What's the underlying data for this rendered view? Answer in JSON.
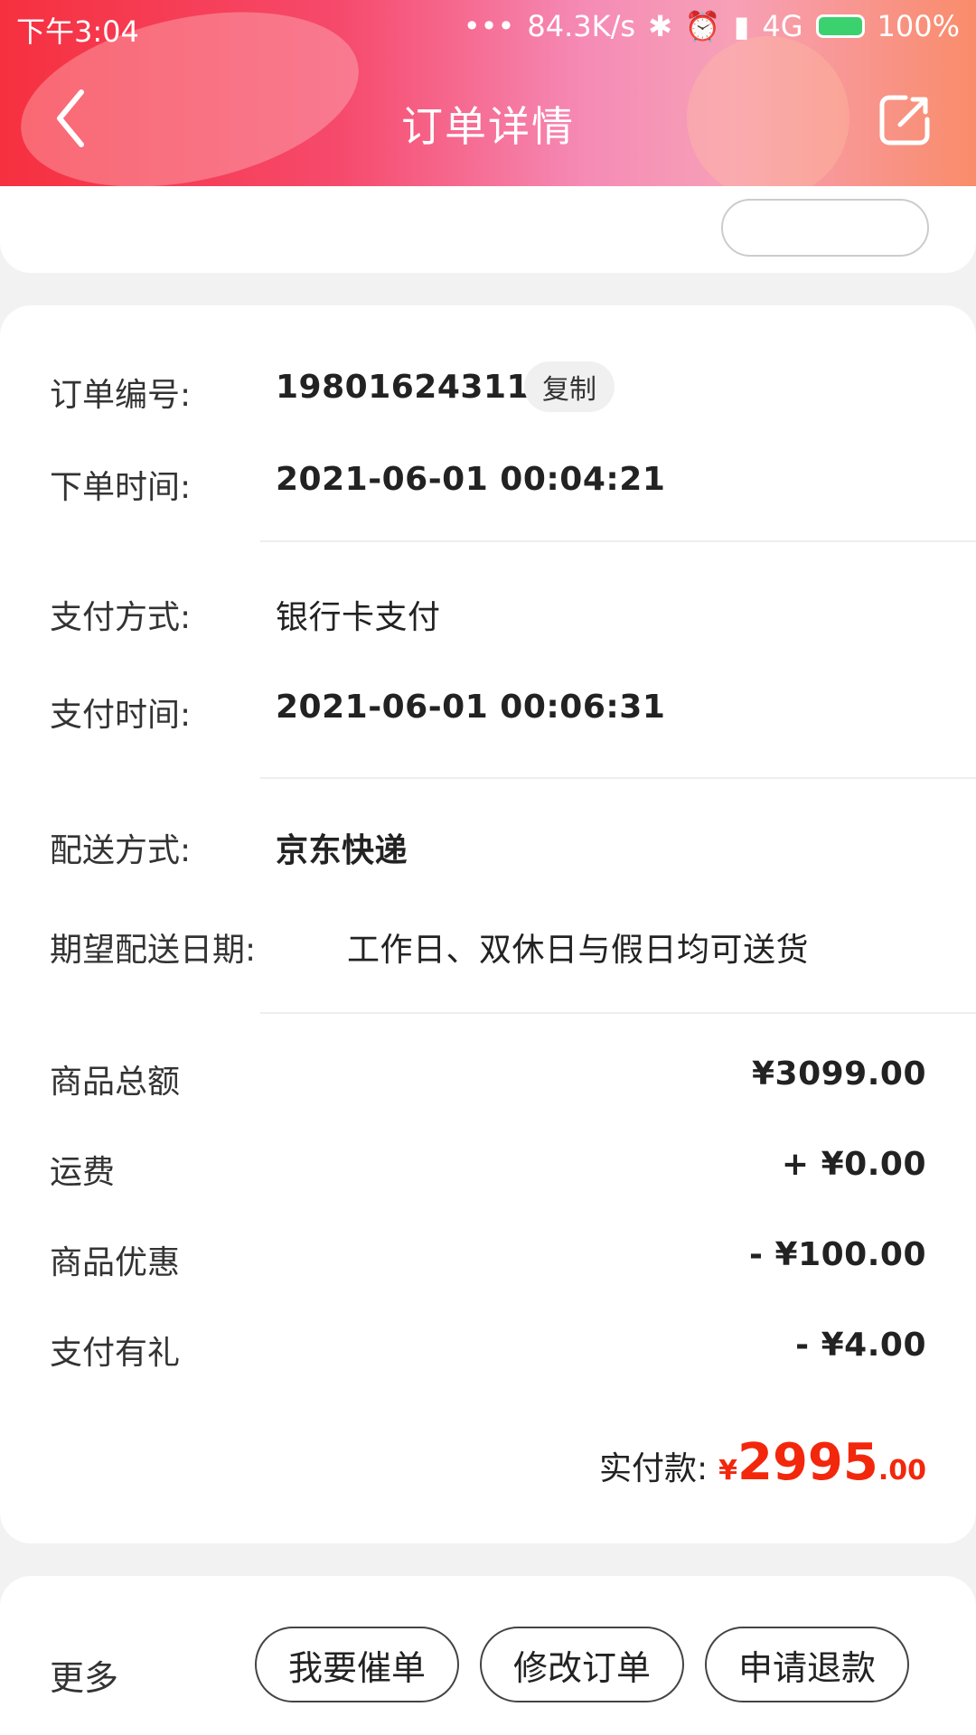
{
  "status_bar": {
    "time": "下午3:04",
    "dots": "•••",
    "speed": "84.3K/s",
    "network": "4G",
    "battery": "100%"
  },
  "nav": {
    "title": "订单详情"
  },
  "order": {
    "number_label": "订单编号:",
    "number": "198016243112",
    "copy_label": "复制",
    "time_label": "下单时间:",
    "time": "2021-06-01 00:04:21"
  },
  "payment": {
    "method_label": "支付方式:",
    "method": "银行卡支付",
    "time_label": "支付时间:",
    "time": "2021-06-01 00:06:31"
  },
  "delivery": {
    "method_label": "配送方式:",
    "method": "京东快递",
    "date_label": "期望配送日期:",
    "date": "工作日、双休日与假日均可送货"
  },
  "amounts": [
    {
      "label": "商品总额",
      "value": "¥3099.00"
    },
    {
      "label": "运费",
      "value": "+ ¥0.00"
    },
    {
      "label": "商品优惠",
      "value": "- ¥100.00"
    },
    {
      "label": "支付有礼",
      "value": "- ¥4.00"
    }
  ],
  "total": {
    "label": "实付款:",
    "currency": "¥",
    "integer": "2995",
    "decimal": ".00"
  },
  "actions": {
    "more": "更多",
    "urge": "我要催单",
    "modify": "修改订单",
    "refund": "申请退款"
  },
  "colors": {
    "accent_red": "#f2270c",
    "header_gradient_start": "#f6303f",
    "header_gradient_end": "#f98c6a"
  }
}
